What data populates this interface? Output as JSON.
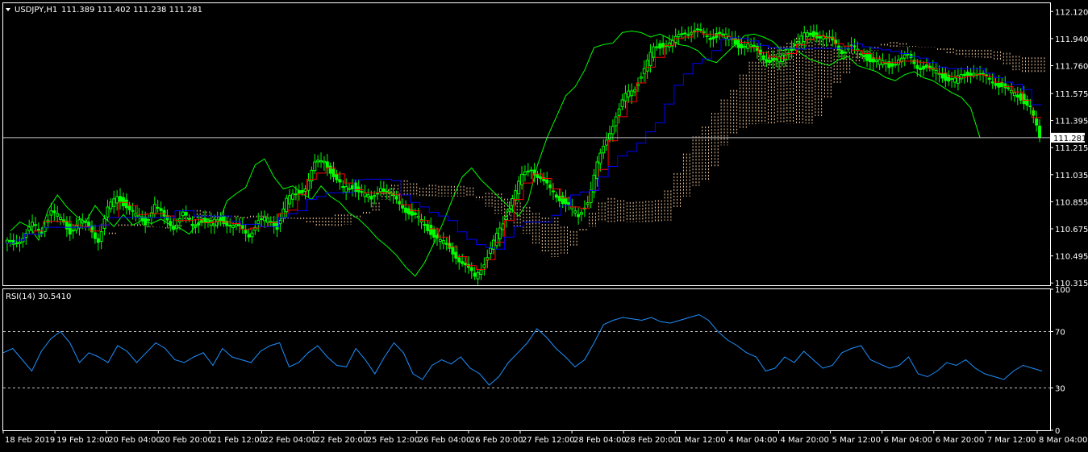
{
  "colors": {
    "background": "#000000",
    "frame": "#ffffff",
    "candle": "#00ff00",
    "chikou": "#00ff00",
    "tenkan": "#ff0000",
    "kijun": "#0000ff",
    "kumo": "#f5c89a",
    "rsi": "#1e90ff",
    "text": "#ffffff"
  },
  "chart_data": [
    {
      "type": "candlestick",
      "title": "USDJPY,H1",
      "ohlc_readout": [
        "111.389",
        "111.402",
        "111.238",
        "111.281"
      ],
      "price_axis_labels": [
        "112.120",
        "111.940",
        "111.760",
        "111.575",
        "111.395",
        "111.215",
        "111.035",
        "110.855",
        "110.675",
        "110.495",
        "110.315"
      ],
      "ylim": [
        110.3,
        112.175
      ],
      "current_price_label": "111.281",
      "current_price": 111.281,
      "indicator": "Ichimoku Kinko Hyo",
      "series": [
        {
          "name": "close",
          "values": [
            110.58,
            110.62,
            110.7,
            110.66,
            110.79,
            110.74,
            110.66,
            110.72,
            110.69,
            110.6,
            110.8,
            110.9,
            110.82,
            110.76,
            110.72,
            110.83,
            110.75,
            110.69,
            110.77,
            110.7,
            110.73,
            110.71,
            110.74,
            110.7,
            110.68,
            110.64,
            110.72,
            110.74,
            110.69,
            110.86,
            110.91,
            110.95,
            111.1,
            111.14,
            111.02,
            110.94,
            110.96,
            110.91,
            110.87,
            110.96,
            110.89,
            110.85,
            110.78,
            110.74,
            110.68,
            110.61,
            110.56,
            110.5,
            110.42,
            110.36,
            110.45,
            110.58,
            110.72,
            110.88,
            111.02,
            111.08,
            111.0,
            110.94,
            110.88,
            110.82,
            110.76,
            110.86,
            111.1,
            111.28,
            111.42,
            111.56,
            111.62,
            111.73,
            111.88,
            111.9,
            111.91,
            111.98,
            111.99,
            111.98,
            111.95,
            111.97,
            111.94,
            111.9,
            111.89,
            111.86,
            111.8,
            111.78,
            111.84,
            111.9,
            111.96,
            111.97,
            111.95,
            111.92,
            111.86,
            111.88,
            111.84,
            111.8,
            111.78,
            111.76,
            111.8,
            111.82,
            111.76,
            111.74,
            111.72,
            111.68,
            111.66,
            111.7,
            111.72,
            111.68,
            111.66,
            111.62,
            111.58,
            111.55,
            111.48,
            111.28
          ]
        }
      ],
      "x_time_labels": [
        "18 Feb 2019",
        "19 Feb 12:00",
        "20 Feb 04:00",
        "20 Feb 20:00",
        "21 Feb 12:00",
        "22 Feb 04:00",
        "22 Feb 20:00",
        "25 Feb 12:00",
        "26 Feb 04:00",
        "26 Feb 20:00",
        "27 Feb 12:00",
        "28 Feb 04:00",
        "28 Feb 20:00",
        "1 Mar 12:00",
        "4 Mar 04:00",
        "4 Mar 20:00",
        "5 Mar 12:00",
        "6 Mar 04:00",
        "6 Mar 20:00",
        "7 Mar 12:00",
        "8 Mar 04:00"
      ]
    },
    {
      "type": "line",
      "title": "RSI(14) 30.5410",
      "axis_labels": [
        "100",
        "70",
        "30",
        "0"
      ],
      "ylim": [
        0,
        100
      ],
      "levels": [
        70,
        30
      ],
      "series": [
        {
          "values": [
            55,
            58,
            50,
            42,
            56,
            65,
            70,
            62,
            48,
            55,
            52,
            48,
            60,
            56,
            48,
            55,
            62,
            58,
            50,
            48,
            52,
            55,
            46,
            58,
            52,
            50,
            48,
            56,
            60,
            62,
            45,
            48,
            55,
            60,
            52,
            46,
            45,
            58,
            50,
            40,
            52,
            62,
            55,
            40,
            36,
            46,
            50,
            47,
            52,
            44,
            40,
            32,
            38,
            48,
            55,
            62,
            72,
            66,
            58,
            52,
            45,
            50,
            62,
            75,
            78,
            80,
            79,
            78,
            80,
            77,
            76,
            78,
            80,
            82,
            78,
            70,
            64,
            60,
            55,
            52,
            42,
            44,
            52,
            48,
            56,
            50,
            44,
            46,
            55,
            58,
            60,
            50,
            47,
            44,
            46,
            52,
            40,
            38,
            42,
            48,
            46,
            50,
            44,
            40,
            38,
            36,
            42,
            46,
            44,
            42
          ]
        }
      ]
    }
  ]
}
